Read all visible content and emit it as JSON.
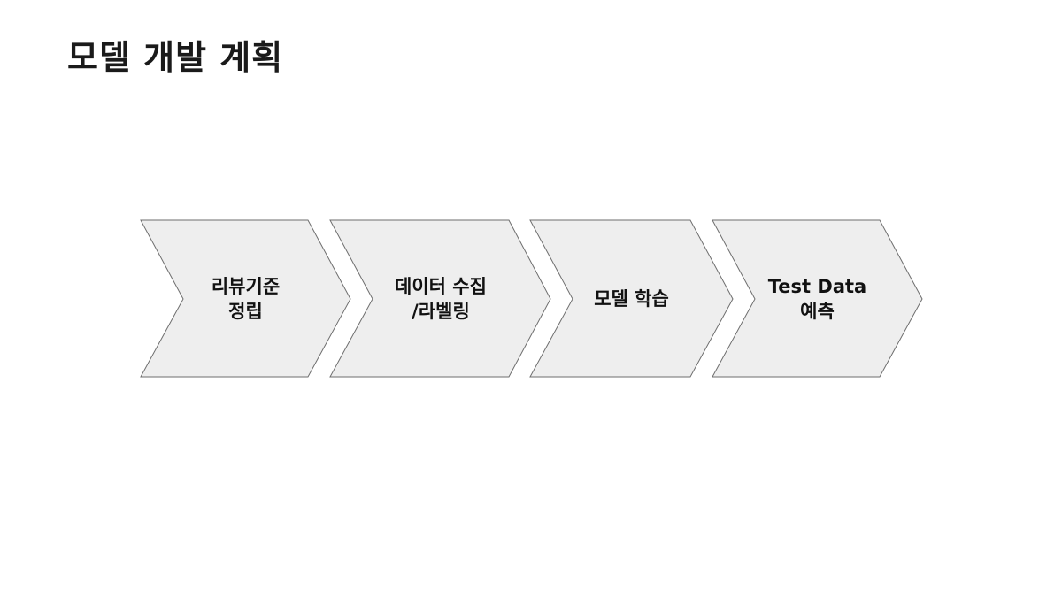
{
  "title": "모델 개발 계획",
  "colors": {
    "chevron_fill": "#eeeeee",
    "chevron_stroke": "#6e6e6e",
    "text": "#111111"
  },
  "steps": [
    {
      "line1": "리뷰기준",
      "line2": "정립"
    },
    {
      "line1": "데이터 수집",
      "line2": "/라벨링"
    },
    {
      "line1": "모델 학습",
      "line2": ""
    },
    {
      "line1": "Test Data",
      "line2": "예측"
    }
  ]
}
